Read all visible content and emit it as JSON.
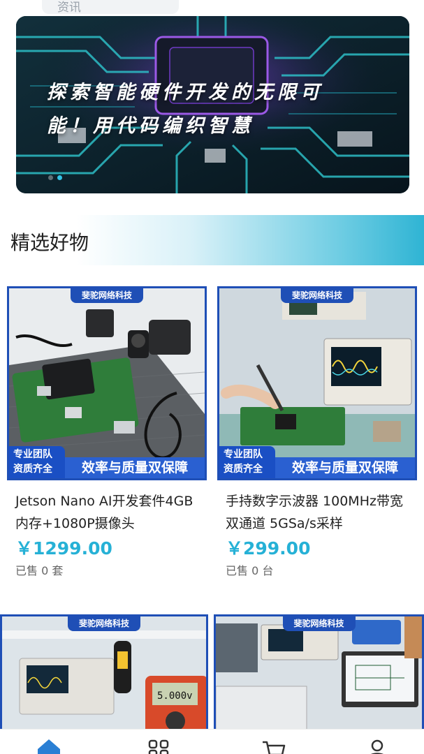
{
  "top_chip": {
    "label": "资讯"
  },
  "banner": {
    "line1": "探索智能硬件开发的无限可",
    "line2": "能！用代码编织智慧",
    "colors": {
      "accent": "#33c3e6"
    }
  },
  "section": {
    "title": "精选好物"
  },
  "products": [
    {
      "brand": "斐驼网络科技",
      "badge_left_1": "专业团队",
      "badge_left_2": "资质齐全",
      "badge_right": "效率与质量双保障",
      "name": "Jetson Nano AI开发套件4GB内存+1080P摄像头",
      "price": "￥1299.00",
      "sold": "已售 0 套"
    },
    {
      "brand": "斐驼网络科技",
      "badge_left_1": "专业团队",
      "badge_left_2": "资质齐全",
      "badge_right": "效率与质量双保障",
      "name": "手持数字示波器 100MHz带宽 双通道 5GSa/s采样",
      "price": "￥299.00",
      "sold": "已售 0 台"
    },
    {
      "brand": "斐驼网络科技"
    },
    {
      "brand": "斐驼网络科技"
    }
  ],
  "tabs": [
    {
      "icon": "home-icon",
      "active": true
    },
    {
      "icon": "category-icon"
    },
    {
      "icon": "cart-icon"
    },
    {
      "icon": "user-icon"
    }
  ],
  "colors": {
    "brand_blue": "#1f4fb6",
    "price": "#26b1d6",
    "tab_active": "#2a7fd4"
  }
}
